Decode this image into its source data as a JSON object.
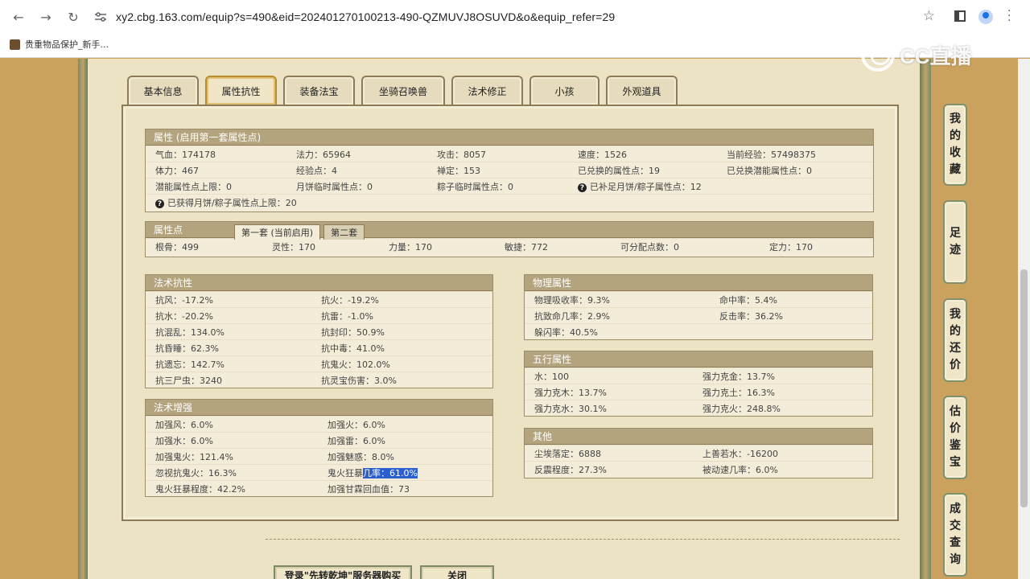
{
  "browser": {
    "url": "xy2.cbg.163.com/equip?s=490&eid=202401270100213-490-QZMUVJ8OSUVD&o&equip_refer=29",
    "bookmark": "贵重物品保护_新手...",
    "watermark": "CC直播"
  },
  "tabs": [
    "基本信息",
    "属性抗性",
    "装备法宝",
    "坐骑召唤兽",
    "法术修正",
    "小孩",
    "外观道具"
  ],
  "attributes": {
    "title": "属性 (启用第一套属性点)",
    "rows": [
      [
        "气血：174178",
        "法力：65964",
        "攻击：8057",
        "速度：1526",
        "当前经验：57498375"
      ],
      [
        "体力：467",
        "经验点：4",
        "禅定：153",
        "已兑换的属性点：19",
        "已兑换潜能属性点：0"
      ],
      [
        "潜能属性点上限：0",
        "月饼临时属性点：0",
        "粽子临时属性点：0",
        "已补足月饼/粽子属性点：12"
      ],
      [
        "已获得月饼/粽子属性点上限：20"
      ]
    ]
  },
  "points": {
    "title": "属性点",
    "tab1": "第一套 (当前启用)",
    "tab2": "第二套",
    "row": [
      "根骨：499",
      "灵性：170",
      "力量：170",
      "敏捷：772",
      "可分配点数：0",
      "定力：170"
    ]
  },
  "resist": {
    "title": "法术抗性",
    "rows": [
      [
        "抗风：-17.2%",
        "抗火：-19.2%"
      ],
      [
        "抗水：-20.2%",
        "抗雷：-1.0%"
      ],
      [
        "抗混乱：134.0%",
        "抗封印：50.9%"
      ],
      [
        "抗昏睡：62.3%",
        "抗中毒：41.0%"
      ],
      [
        "抗遗忘：142.7%",
        "抗鬼火：102.0%"
      ],
      [
        "抗三尸虫：3240",
        "抗灵宝伤害：3.0%"
      ]
    ]
  },
  "enhance": {
    "title": "法术增强",
    "rows": [
      [
        "加强风：6.0%",
        "加强火：6.0%"
      ],
      [
        "加强水：6.0%",
        "加强雷：6.0%"
      ],
      [
        "加强鬼火：121.4%",
        "加强魅惑：8.0%"
      ],
      [
        "忽视抗鬼火：16.3%",
        "鬼火狂暴",
        "几率：61.0%"
      ],
      [
        "鬼火狂暴程度：42.2%",
        "加强甘霖回血值：73"
      ]
    ]
  },
  "physical": {
    "title": "物理属性",
    "rows": [
      [
        "物理吸收率：9.3%",
        "命中率：5.4%"
      ],
      [
        "抗致命几率：2.9%",
        "反击率：36.2%"
      ],
      [
        "躲闪率：40.5%"
      ]
    ]
  },
  "five": {
    "title": "五行属性",
    "rows": [
      [
        "水：100",
        "强力克金：13.7%"
      ],
      [
        "强力克木：13.7%",
        "强力克土：16.3%"
      ],
      [
        "强力克水：30.1%",
        "强力克火：248.8%"
      ]
    ]
  },
  "other": {
    "title": "其他",
    "rows": [
      [
        "尘埃落定：6888",
        "上善若水：-16200"
      ],
      [
        "反震程度：27.3%",
        "被动速几率：6.0%"
      ]
    ]
  },
  "bottom": {
    "btn1": "登录\"先转乾坤\"服务器购买",
    "btn2": "关闭"
  },
  "side_nav": [
    [
      "我",
      "的",
      "收",
      "藏"
    ],
    [
      "足",
      "迹"
    ],
    [
      "我",
      "的",
      "还",
      "价"
    ],
    [
      "估",
      "价",
      "鉴",
      "宝"
    ],
    [
      "成",
      "交",
      "查",
      "询"
    ]
  ]
}
